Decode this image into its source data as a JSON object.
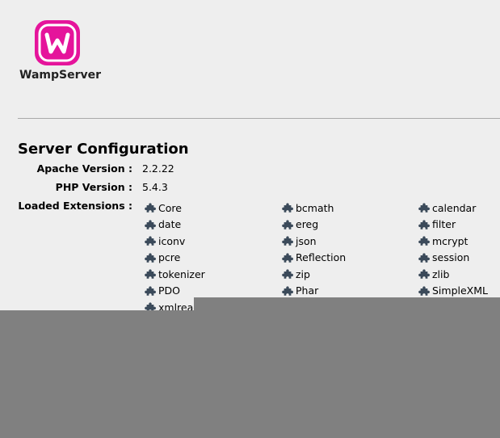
{
  "brand": {
    "name": "WampServer",
    "accent": "#e5149b"
  },
  "section": {
    "title": "Server Configuration"
  },
  "config": {
    "apache_label": "Apache Version :",
    "apache_value": "2.2.22",
    "php_label": "PHP Version :",
    "php_value": "5.4.3",
    "extensions_label": "Loaded Extensions :"
  },
  "extensions": [
    "Core",
    "bcmath",
    "calendar",
    "date",
    "ereg",
    "filter",
    "iconv",
    "json",
    "mcrypt",
    "pcre",
    "Reflection",
    "session",
    "tokenizer",
    "zip",
    "zlib",
    "PDO",
    "Phar",
    "SimpleXML",
    "xmlreader"
  ],
  "extension_icon": "puzzle-piece-icon",
  "overlay_color": "#808080"
}
